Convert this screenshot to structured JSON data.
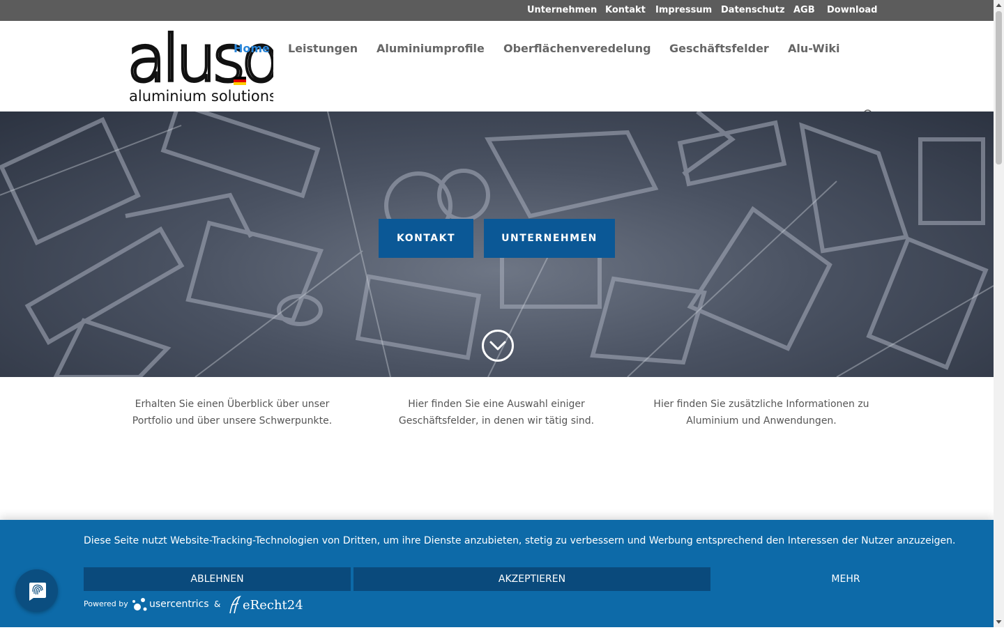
{
  "topbar": {
    "links": [
      "Unternehmen",
      "Kontakt",
      "Impressum",
      "Datenschutz",
      "AGB",
      "Download"
    ]
  },
  "logo": {
    "wordmark": "aluso",
    "tagline": "aluminium solutions"
  },
  "nav": {
    "items": [
      "Home",
      "Leistungen",
      "Aluminiumprofile",
      "Oberflächenveredelung",
      "Geschäftsfelder",
      "Alu-Wiki"
    ],
    "active_index": 0
  },
  "hero": {
    "buttons": [
      "KONTAKT",
      "UNTERNEHMEN"
    ]
  },
  "features": [
    {
      "text": "Erhalten Sie einen Überblick über unser Portfolio und über unsere Schwerpunkte."
    },
    {
      "text": "Hier finden Sie eine Auswahl einiger Geschäftsfelder, in denen wir tätig sind."
    },
    {
      "text": "Hier finden Sie zusätzliche Informationen zu Aluminium und Anwendungen."
    }
  ],
  "cookie": {
    "message": "Diese Seite nutzt Website-Tracking-Technologien von Dritten, um ihre Dienste anzubieten, stetig zu verbessern und Werbung entsprechend den Interessen der Nutzer anzuzeigen.",
    "reject_label": "ABLEHNEN",
    "accept_label": "AKZEPTIEREN",
    "more_label": "MEHR",
    "powered_by": "Powered by",
    "usercentrics": "usercentrics",
    "amp": "&",
    "erecht": "eRecht24"
  },
  "colors": {
    "topbar": "#5c5c5c",
    "nav_active": "#2b87da",
    "hero_button": "#0b5896",
    "cookie_bg": "#0d6aa8",
    "cookie_button": "#0a4a7c"
  },
  "icons": {
    "search": "search-icon",
    "scroll_down": "chevron-down-circle-icon",
    "privacy": "fingerprint-icon",
    "flag": "german-flag-icon"
  }
}
